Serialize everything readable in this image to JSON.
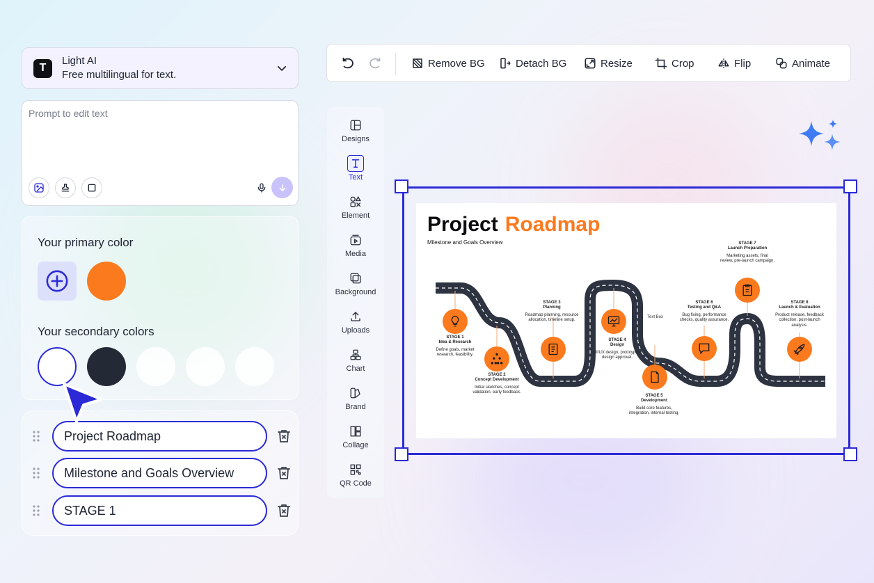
{
  "colors": {
    "accent": "#2b2ad6",
    "brand_orange": "#fb7a1e",
    "dark": "#242936",
    "send_button": "#c9c3fb"
  },
  "model": {
    "name": "Light AI",
    "description": "Free multilingual for text.",
    "logo_letter": "T",
    "chevron_icon": "chevron-down-icon"
  },
  "prompt": {
    "placeholder": "Prompt to edit text",
    "value": "",
    "tools": [
      "image-edit-icon",
      "stamp-icon",
      "square-icon"
    ],
    "mic_icon": "microphone-icon",
    "send_icon": "arrow-down-icon"
  },
  "palette": {
    "primary_title": "Your primary color",
    "primary_colors": [
      "#fb7a1e"
    ],
    "secondary_title": "Your secondary colors",
    "secondary_colors": [
      "#ffffff",
      "#242936",
      "#ffffff",
      "#ffffff",
      "#ffffff"
    ],
    "selected_secondary_index": 0
  },
  "text_layers": [
    {
      "value": "Project Roadmap"
    },
    {
      "value": "Milestone and Goals Overview"
    },
    {
      "value": "STAGE 1"
    }
  ],
  "toolbar": {
    "undo_icon": "undo-icon",
    "redo_icon": "redo-icon",
    "buttons": [
      {
        "label": "Remove BG",
        "icon": "remove-bg-icon"
      },
      {
        "label": "Detach BG",
        "icon": "detach-bg-icon"
      },
      {
        "label": "Resize",
        "icon": "resize-icon"
      },
      {
        "label": "Crop",
        "icon": "crop-icon"
      },
      {
        "label": "Flip",
        "icon": "flip-icon"
      },
      {
        "label": "Animate",
        "icon": "animate-icon"
      }
    ]
  },
  "side_menu": {
    "active": "Text",
    "items": [
      {
        "label": "Designs",
        "icon": "designs-icon"
      },
      {
        "label": "Text",
        "icon": "text-icon"
      },
      {
        "label": "Element",
        "icon": "element-icon"
      },
      {
        "label": "Media",
        "icon": "media-icon"
      },
      {
        "label": "Background",
        "icon": "background-icon"
      },
      {
        "label": "Uploads",
        "icon": "upload-icon"
      },
      {
        "label": "Chart",
        "icon": "chart-icon"
      },
      {
        "label": "Brand",
        "icon": "brand-icon"
      },
      {
        "label": "Collage",
        "icon": "collage-icon"
      },
      {
        "label": "QR Code",
        "icon": "qr-code-icon"
      }
    ]
  },
  "design": {
    "title_main": "Project",
    "title_accent": "Roadmap",
    "subtitle": "Milestone and Goals Overview",
    "textbox_label": "Text Box",
    "stages": [
      {
        "stage": "STAGE 1",
        "name": "Idea & Research",
        "desc": "Define goals, market research, feasibility.",
        "icon": "lightbulb-icon"
      },
      {
        "stage": "STAGE 2",
        "name": "Concept Development",
        "desc": "Initial sketches, concept validation, early feedback.",
        "icon": "hierarchy-icon"
      },
      {
        "stage": "STAGE 3",
        "name": "Planning",
        "desc": "Roadmap planning, resource allocation, timeline setup.",
        "icon": "notebook-icon"
      },
      {
        "stage": "STAGE 4",
        "name": "Design",
        "desc": "UI/UX design, prototypes, design approval.",
        "icon": "monitor-chart-icon"
      },
      {
        "stage": "STAGE 5",
        "name": "Development",
        "desc": "Build core features, integration, internal testing.",
        "icon": "document-icon"
      },
      {
        "stage": "STAGE 6",
        "name": "Testing and Q&A",
        "desc": "Bug fixing, performance checks, quality assurance.",
        "icon": "chat-bubble-icon"
      },
      {
        "stage": "STAGE 7",
        "name": "Launch Preparation",
        "desc": "Marketing assets, final review, pre-launch campaign.",
        "icon": "clipboard-icon"
      },
      {
        "stage": "STAGE 8",
        "name": "Launch & Evaluation",
        "desc": "Product release, feedback collection, post-launch analysis.",
        "icon": "rocket-icon"
      }
    ]
  }
}
